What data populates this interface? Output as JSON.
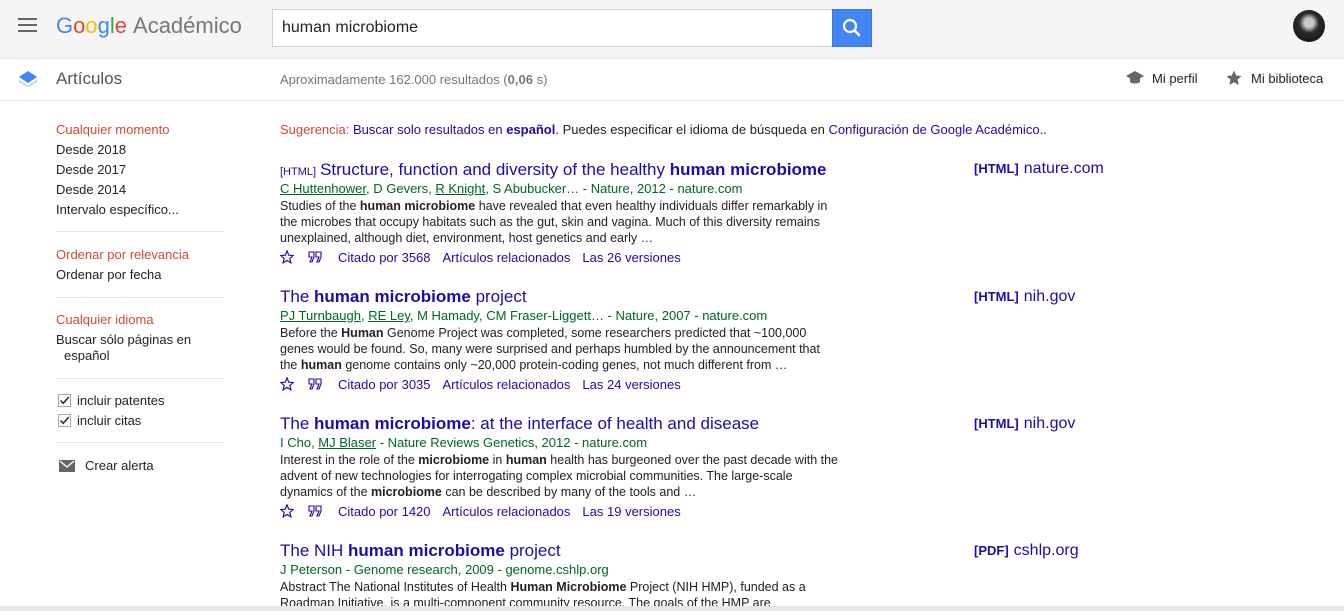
{
  "logo": {
    "g1": "G",
    "g2": "o",
    "g3": "o",
    "g4": "g",
    "g5": "l",
    "g6": "e",
    "product": "Académico"
  },
  "search": {
    "value": "human microbiome"
  },
  "subbar": {
    "section": "Artículos",
    "count_prefix": "Aproximadamente 162.000 resultados (",
    "count_time": "0,06",
    "count_suffix": " s)",
    "profile": "Mi perfil",
    "library": "Mi biblioteca"
  },
  "sidebar": {
    "time": [
      "Cualquier momento",
      "Desde 2018",
      "Desde 2017",
      "Desde 2014",
      "Intervalo específico..."
    ],
    "sort": [
      "Ordenar por relevancia",
      "Ordenar por fecha"
    ],
    "lang": [
      "Cualquier idioma",
      "Buscar sólo páginas en",
      "español"
    ],
    "patents": "incluir patentes",
    "citations": "incluir citas",
    "alert": "Crear alerta"
  },
  "suggestion": {
    "label": "Sugerencia:",
    "link1": "Buscar solo resultados en ",
    "link1_bold": "español",
    "mid": ". Puedes especificar el idioma de búsqueda en ",
    "link2": "Configuración de Google Académico",
    "end": ".."
  },
  "results": [
    {
      "tag": "[HTML]",
      "title_a": "Structure, function and diversity of the healthy ",
      "title_b": "human microbiome",
      "title_c": "",
      "authors": [
        "C Huttenhower",
        ", D Gevers, ",
        "R Knight",
        ", S Abubucker… - Nature, 2012 - nature.com"
      ],
      "snippet": [
        "Studies of the ",
        "human microbiome",
        " have revealed that even healthy individuals differ remarkably in the microbes that occupy habitats such as the gut, skin and vagina. Much of this diversity remains unexplained, although diet, environment, host genetics and early …"
      ],
      "cited": "Citado por 3568",
      "related": "Artículos relacionados",
      "versions": "Las 26 versiones",
      "side_tag": "[HTML]",
      "side_site": "nature.com"
    },
    {
      "tag": "",
      "title_a": "The ",
      "title_b": "human microbiome",
      "title_c": " project",
      "authors": [
        "PJ Turnbaugh",
        ", ",
        "RE Ley",
        ", M Hamady, CM Fraser-Liggett… - Nature, 2007 - nature.com"
      ],
      "snippet": [
        "Before the ",
        "Human",
        " Genome Project was completed, some researchers predicted that ~100,000 genes would be found. So, many were surprised and perhaps humbled by the announcement that the ",
        "human",
        " genome contains only ~20,000 protein-coding genes, not much different from …"
      ],
      "cited": "Citado por 3035",
      "related": "Artículos relacionados",
      "versions": "Las 24 versiones",
      "side_tag": "[HTML]",
      "side_site": "nih.gov"
    },
    {
      "tag": "",
      "title_a": "The ",
      "title_b": "human microbiome",
      "title_c": ": at the interface of health and disease",
      "authors": [
        "I Cho, ",
        "MJ Blaser",
        " - Nature Reviews Genetics, 2012 - nature.com"
      ],
      "snippet": [
        "Interest in the role of the ",
        "microbiome",
        " in ",
        "human",
        " health has burgeoned over the past decade with the advent of new technologies for interrogating complex microbial communities. The large-scale dynamics of the ",
        "microbiome",
        " can be described by many of the tools and …"
      ],
      "cited": "Citado por 1420",
      "related": "Artículos relacionados",
      "versions": "Las 19 versiones",
      "side_tag": "[HTML]",
      "side_site": "nih.gov"
    },
    {
      "tag": "",
      "title_a": "The NIH ",
      "title_b": "human microbiome",
      "title_c": " project",
      "authors": [
        "J Peterson - Genome research, 2009 - genome.cshlp.org"
      ],
      "snippet": [
        "Abstract The National Institutes of Health ",
        "Human Microbiome",
        " Project (NIH HMP), funded as a Roadmap Initiative, is a multi-component community resource. The goals of the HMP are"
      ],
      "side_tag": "[PDF]",
      "side_site": "cshlp.org"
    }
  ]
}
